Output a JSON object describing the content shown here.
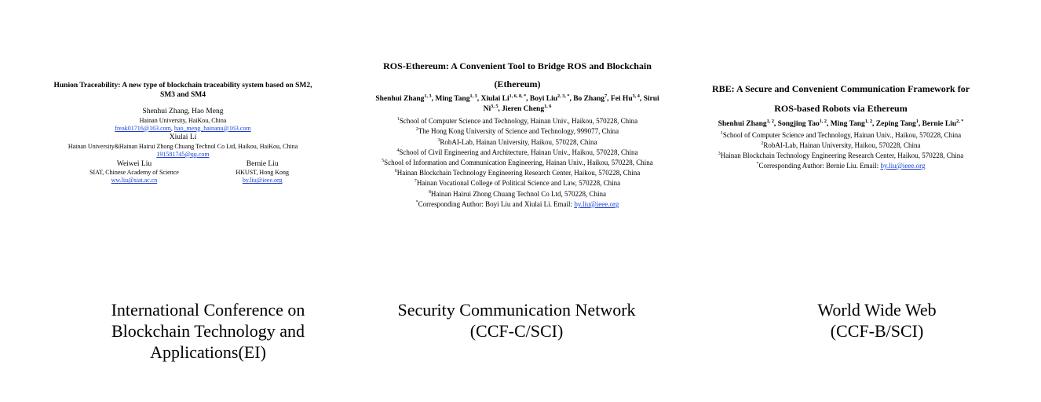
{
  "papers": [
    {
      "title": "Hunion Traceability: A new type of blockchain traceability system based on SM2, SM3 and SM4",
      "authors_line1": "Shenhui Zhang, Hao Meng",
      "affiliation1": "Hainan University, HaiKou, China",
      "emails1": [
        "freak01716@163.com",
        "hao_meng_hainanu@163.com"
      ],
      "author2": "Xiulai Li",
      "affiliation2": "Hainan University&Hainan Hairui Zhong Chuang Technol Co Ltd, Haikou, HaiKou, China",
      "email2": "191581745@qq.com",
      "left_author": {
        "name": "Weiwei Liu",
        "affiliation": "SIAT, Chinese Academy of Science",
        "email": "ww.liu@siat.ac.cn"
      },
      "right_author": {
        "name": "Bernie Liu",
        "affiliation": "HKUST, Hong Kong",
        "email": "by.liu@ieee.org"
      }
    },
    {
      "title_line1": "ROS-Ethereum: A Convenient Tool to Bridge ROS and Blockchain",
      "title_line2": "(Ethereum)",
      "authors": [
        {
          "name": "Shenhui Zhang",
          "sup": "1, 3"
        },
        {
          "name": "Ming Tang",
          "sup": "1, 3"
        },
        {
          "name": "Xiulai Li",
          "sup": "1, 6, 8, *"
        },
        {
          "name": "Boyi Liu",
          "sup": "2, 3, *"
        },
        {
          "name": "Bo Zhang",
          "sup": "7"
        },
        {
          "name": "Fei Hu",
          "sup": "3, 4"
        },
        {
          "name": "Sirui Ni",
          "sup": "3, 5"
        },
        {
          "name": "Jieren Cheng",
          "sup": "1, 6"
        }
      ],
      "affiliations": [
        {
          "sup": "1",
          "text": "School of Computer Science and Technology, Hainan Univ., Haikou, 570228, China"
        },
        {
          "sup": "2",
          "text": "The Hong Kong University of Science and Technology, 999077, China"
        },
        {
          "sup": "3",
          "text": "RobAI-Lab, Hainan University, Haikou, 570228, China"
        },
        {
          "sup": "4",
          "text": "School of Civil Engineering and Architecture, Hainan Univ., Haikou, 570228, China"
        },
        {
          "sup": "5",
          "text": "School of Information and Communication Engineering, Hainan Univ., Haikou, 570228, China"
        },
        {
          "sup": "6",
          "text": "Hainan Blockchain Technology Engineering Research Center, Haikou, 570228, China"
        },
        {
          "sup": "7",
          "text": "Hainan Vocational College of Political Science and Law, 570228, China"
        },
        {
          "sup": "8",
          "text": "Hainan Hairui Zhong Chuang Technol Co Ltd, 570228, China"
        }
      ],
      "corresponding_text": "Corresponding Author: Boyi Liu and Xiulai Li. Email: ",
      "corresponding_email": "by.liu@ieee.org"
    },
    {
      "title_line1": "RBE: A Secure and Convenient Communication Framework for",
      "title_line2": "ROS-based Robots via Ethereum",
      "authors": [
        {
          "name": "Shenhui Zhang",
          "sup": "1, 2"
        },
        {
          "name": "Songjing Tao",
          "sup": "1, 2"
        },
        {
          "name": "Ming Tang",
          "sup": "1, 2"
        },
        {
          "name": "Zeping Tang",
          "sup": "1"
        },
        {
          "name": "Bernie Liu",
          "sup": "2, *"
        }
      ],
      "affiliations": [
        {
          "sup": "1",
          "text": "School of Computer Science and Technology, Hainan Univ., Haikou, 570228, China"
        },
        {
          "sup": "2",
          "text": "RobAI-Lab, Hainan University, Haikou, 570228, China"
        },
        {
          "sup": "3",
          "text": "Hainan Blockchain Technology Engineering Research Center, Haikou, 570228, China"
        }
      ],
      "corresponding_text": "Corresponding Author: Bernie Liu. Email: ",
      "corresponding_email": "by.liu@ieee.org"
    }
  ],
  "venues": [
    {
      "line1": "International Conference on",
      "line2": "Blockchain Technology and",
      "line3": "Applications(EI)"
    },
    {
      "line1": "Security Communication Network",
      "line2": "(CCF-C/SCI)"
    },
    {
      "line1": "World Wide Web",
      "line2": "(CCF-B/SCI)"
    }
  ]
}
